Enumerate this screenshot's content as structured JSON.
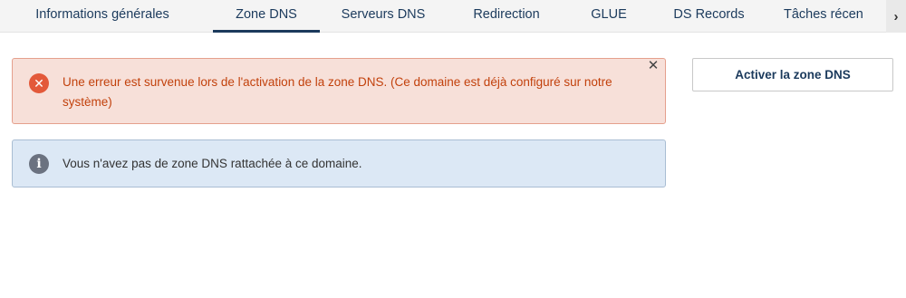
{
  "tabs": [
    {
      "label": "Informations générales",
      "active": false
    },
    {
      "label": "Zone DNS",
      "active": true
    },
    {
      "label": "Serveurs DNS",
      "active": false
    },
    {
      "label": "Redirection",
      "active": false
    },
    {
      "label": "GLUE",
      "active": false
    },
    {
      "label": "DS Records",
      "active": false
    },
    {
      "label": "Tâches récen",
      "active": false
    }
  ],
  "tab_scroll_icon": "chevron-right-icon",
  "error_alert": {
    "icon": "error-x-icon",
    "message": "Une erreur est survenue lors de l'activation de la zone DNS. (Ce domaine est déjà configuré sur notre système)",
    "close_icon": "close-icon"
  },
  "info_alert": {
    "icon": "info-icon",
    "message": "Vous n'avez pas de zone DNS rattachée à ce domaine."
  },
  "actions": {
    "activate_label": "Activer la zone DNS"
  },
  "colors": {
    "primary": "#1b3a5c",
    "error_bg": "#f7e0d9",
    "error_text": "#c2410c",
    "info_bg": "#dce8f5"
  }
}
